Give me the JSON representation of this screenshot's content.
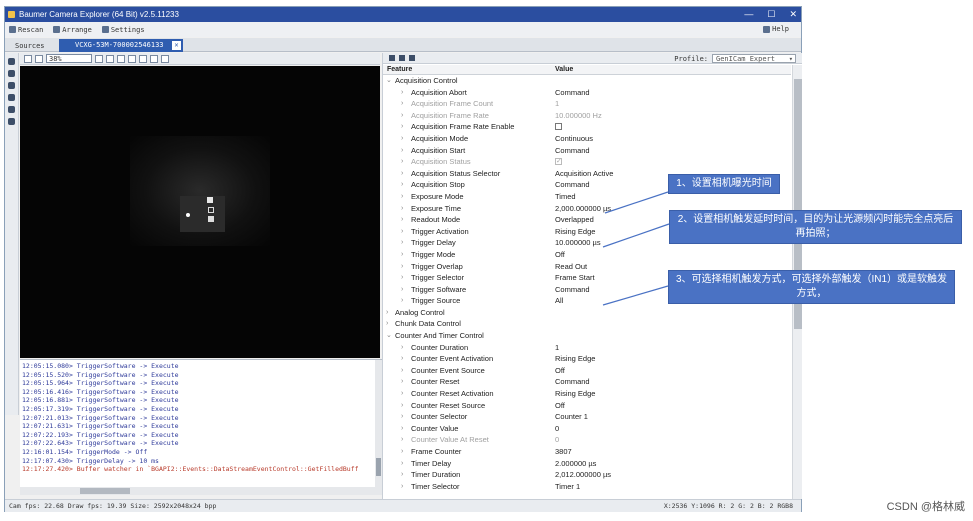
{
  "window": {
    "title": "Baumer Camera Explorer (64 Bit) v2.5.11233",
    "buttons": [
      "—",
      "☐",
      "✕"
    ]
  },
  "menu": {
    "rescan": "Rescan",
    "arrange": "Arrange",
    "settings": "Settings",
    "help": "Help"
  },
  "tabs": {
    "sources": "Sources",
    "device": "VCXG-53M-700002546133"
  },
  "image_toolbar": {
    "zoom": "38%"
  },
  "log": [
    {
      "text": "12:05:15.080> TriggerSoftware -> Execute",
      "type": "info"
    },
    {
      "text": "12:05:15.520> TriggerSoftware -> Execute",
      "type": "info"
    },
    {
      "text": "12:05:15.964> TriggerSoftware -> Execute",
      "type": "info"
    },
    {
      "text": "12:05:16.416> TriggerSoftware -> Execute",
      "type": "info"
    },
    {
      "text": "12:05:16.881> TriggerSoftware -> Execute",
      "type": "info"
    },
    {
      "text": "12:05:17.319> TriggerSoftware -> Execute",
      "type": "info"
    },
    {
      "text": "12:07:21.013> TriggerSoftware -> Execute",
      "type": "info"
    },
    {
      "text": "12:07:21.631> TriggerSoftware -> Execute",
      "type": "info"
    },
    {
      "text": "12:07:22.193> TriggerSoftware -> Execute",
      "type": "info"
    },
    {
      "text": "12:07:22.643> TriggerSoftware -> Execute",
      "type": "info"
    },
    {
      "text": "12:16:01.154> TriggerMode -> Off",
      "type": "info"
    },
    {
      "text": "12:17:07.430> TriggerDelay -> 10 ms",
      "type": "info"
    },
    {
      "text": "12:17:27.420> Buffer watcher in `BGAPI2::Events::DataStreamEventControl::GetFilledBuff",
      "type": "err"
    }
  ],
  "status": {
    "left": "Cam fps: 22.68 Draw fps: 19.39 Size: 2592x2048x24 bpp",
    "right": "X:2536 Y:1096 R: 2 G: 2 B: 2 RGB8"
  },
  "profile": {
    "label": "Profile:",
    "value": "GenICam Expert"
  },
  "columns": {
    "feature": "Feature",
    "value": "Value"
  },
  "features": [
    {
      "kind": "cat",
      "name": "Acquisition Control",
      "value": "",
      "open": true
    },
    {
      "kind": "item",
      "name": "Acquisition Abort",
      "value": "Command"
    },
    {
      "kind": "item",
      "name": "Acquisition Frame Count",
      "value": "1",
      "disabled": true
    },
    {
      "kind": "item",
      "name": "Acquisition Frame Rate",
      "value": "10.000000 Hz",
      "disabled": true
    },
    {
      "kind": "item",
      "name": "Acquisition Frame Rate Enable",
      "value": "",
      "check": "off"
    },
    {
      "kind": "item",
      "name": "Acquisition Mode",
      "value": "Continuous"
    },
    {
      "kind": "item",
      "name": "Acquisition Start",
      "value": "Command"
    },
    {
      "kind": "item",
      "name": "Acquisition Status",
      "value": "",
      "check": "on",
      "disabled": true
    },
    {
      "kind": "item",
      "name": "Acquisition Status Selector",
      "value": "Acquisition Active"
    },
    {
      "kind": "item",
      "name": "Acquisition Stop",
      "value": "Command"
    },
    {
      "kind": "item",
      "name": "Exposure Mode",
      "value": "Timed"
    },
    {
      "kind": "item",
      "name": "Exposure Time",
      "value": "2,000.000000 µs"
    },
    {
      "kind": "item",
      "name": "Readout Mode",
      "value": "Overlapped"
    },
    {
      "kind": "item",
      "name": "Trigger Activation",
      "value": "Rising Edge"
    },
    {
      "kind": "item",
      "name": "Trigger Delay",
      "value": "10.000000 µs"
    },
    {
      "kind": "item",
      "name": "Trigger Mode",
      "value": "Off"
    },
    {
      "kind": "item",
      "name": "Trigger Overlap",
      "value": "Read Out"
    },
    {
      "kind": "item",
      "name": "Trigger Selector",
      "value": "Frame Start"
    },
    {
      "kind": "item",
      "name": "Trigger Software",
      "value": "Command"
    },
    {
      "kind": "item",
      "name": "Trigger Source",
      "value": "All"
    },
    {
      "kind": "cat",
      "name": "Analog Control",
      "value": "",
      "open": false
    },
    {
      "kind": "cat",
      "name": "Chunk Data Control",
      "value": "",
      "open": false
    },
    {
      "kind": "cat",
      "name": "Counter And Timer Control",
      "value": "",
      "open": true
    },
    {
      "kind": "item",
      "name": "Counter Duration",
      "value": "1"
    },
    {
      "kind": "item",
      "name": "Counter Event Activation",
      "value": "Rising Edge"
    },
    {
      "kind": "item",
      "name": "Counter Event Source",
      "value": "Off"
    },
    {
      "kind": "item",
      "name": "Counter Reset",
      "value": "Command"
    },
    {
      "kind": "item",
      "name": "Counter Reset Activation",
      "value": "Rising Edge"
    },
    {
      "kind": "item",
      "name": "Counter Reset Source",
      "value": "Off"
    },
    {
      "kind": "item",
      "name": "Counter Selector",
      "value": "Counter 1"
    },
    {
      "kind": "item",
      "name": "Counter Value",
      "value": "0"
    },
    {
      "kind": "item",
      "name": "Counter Value At Reset",
      "value": "0",
      "disabled": true
    },
    {
      "kind": "item",
      "name": "Frame Counter",
      "value": "3807"
    },
    {
      "kind": "item",
      "name": "Timer Delay",
      "value": "2.000000 µs"
    },
    {
      "kind": "item",
      "name": "Timer Duration",
      "value": "2,012.000000 µs"
    },
    {
      "kind": "item",
      "name": "Timer Selector",
      "value": "Timer 1"
    }
  ],
  "callouts": {
    "c1": "1、设置相机曝光时间",
    "c2": "2、设置相机触发延时时间，目的为让光源频闪时能完全点亮后再拍照；",
    "c3": "3、可选择相机触发方式，可选择外部触发（IN1）或是软触发方式，"
  },
  "watermark": "CSDN @格林威"
}
